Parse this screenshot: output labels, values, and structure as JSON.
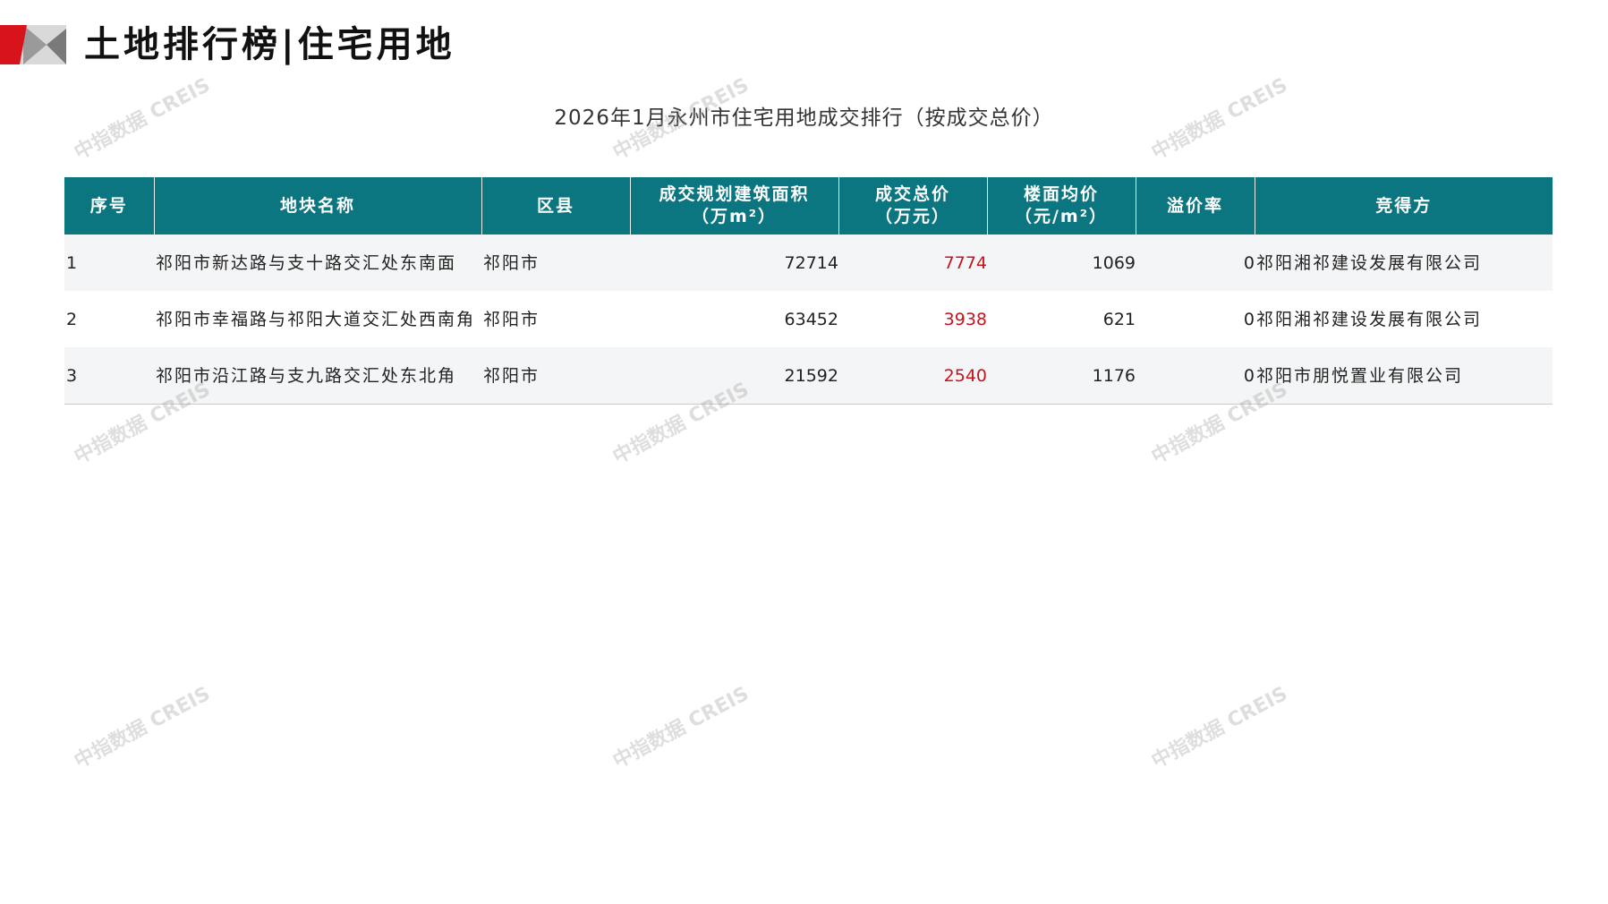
{
  "header": {
    "title": "土地排行榜|住宅用地",
    "logo_colors": {
      "red": "#d7141c",
      "grey": "#9a9a9a",
      "light": "#d9d9d9"
    }
  },
  "table": {
    "caption": "2026年1月永州市住宅用地成交排行（按成交总价）",
    "header_color": "#0b7580",
    "highlight_color": "#c8141e",
    "columns": [
      {
        "l1": "序号",
        "l2": ""
      },
      {
        "l1": "地块名称",
        "l2": ""
      },
      {
        "l1": "区县",
        "l2": ""
      },
      {
        "l1": "成交规划建筑面积",
        "l2": "（万m²）"
      },
      {
        "l1": "成交总价",
        "l2": "（万元）"
      },
      {
        "l1": "楼面均价",
        "l2": "（元/m²）"
      },
      {
        "l1": "溢价率",
        "l2": ""
      },
      {
        "l1": "竞得方",
        "l2": ""
      }
    ],
    "rows": [
      {
        "rank": "1",
        "name": "祁阳市新达路与支十路交汇处东南面",
        "district": "祁阳市",
        "area": "72714",
        "total": "7774",
        "unit_price": "1069",
        "premium": "0",
        "buyer": "祁阳湘祁建设发展有限公司"
      },
      {
        "rank": "2",
        "name": "祁阳市幸福路与祁阳大道交汇处西南角",
        "district": "祁阳市",
        "area": "63452",
        "total": "3938",
        "unit_price": "621",
        "premium": "0",
        "buyer": "祁阳湘祁建设发展有限公司"
      },
      {
        "rank": "3",
        "name": "祁阳市沿江路与支九路交汇处东北角",
        "district": "祁阳市",
        "area": "21592",
        "total": "2540",
        "unit_price": "1176",
        "premium": "0",
        "buyer": "祁阳市朋悦置业有限公司"
      }
    ]
  },
  "watermark": "中指数据 CREIS"
}
